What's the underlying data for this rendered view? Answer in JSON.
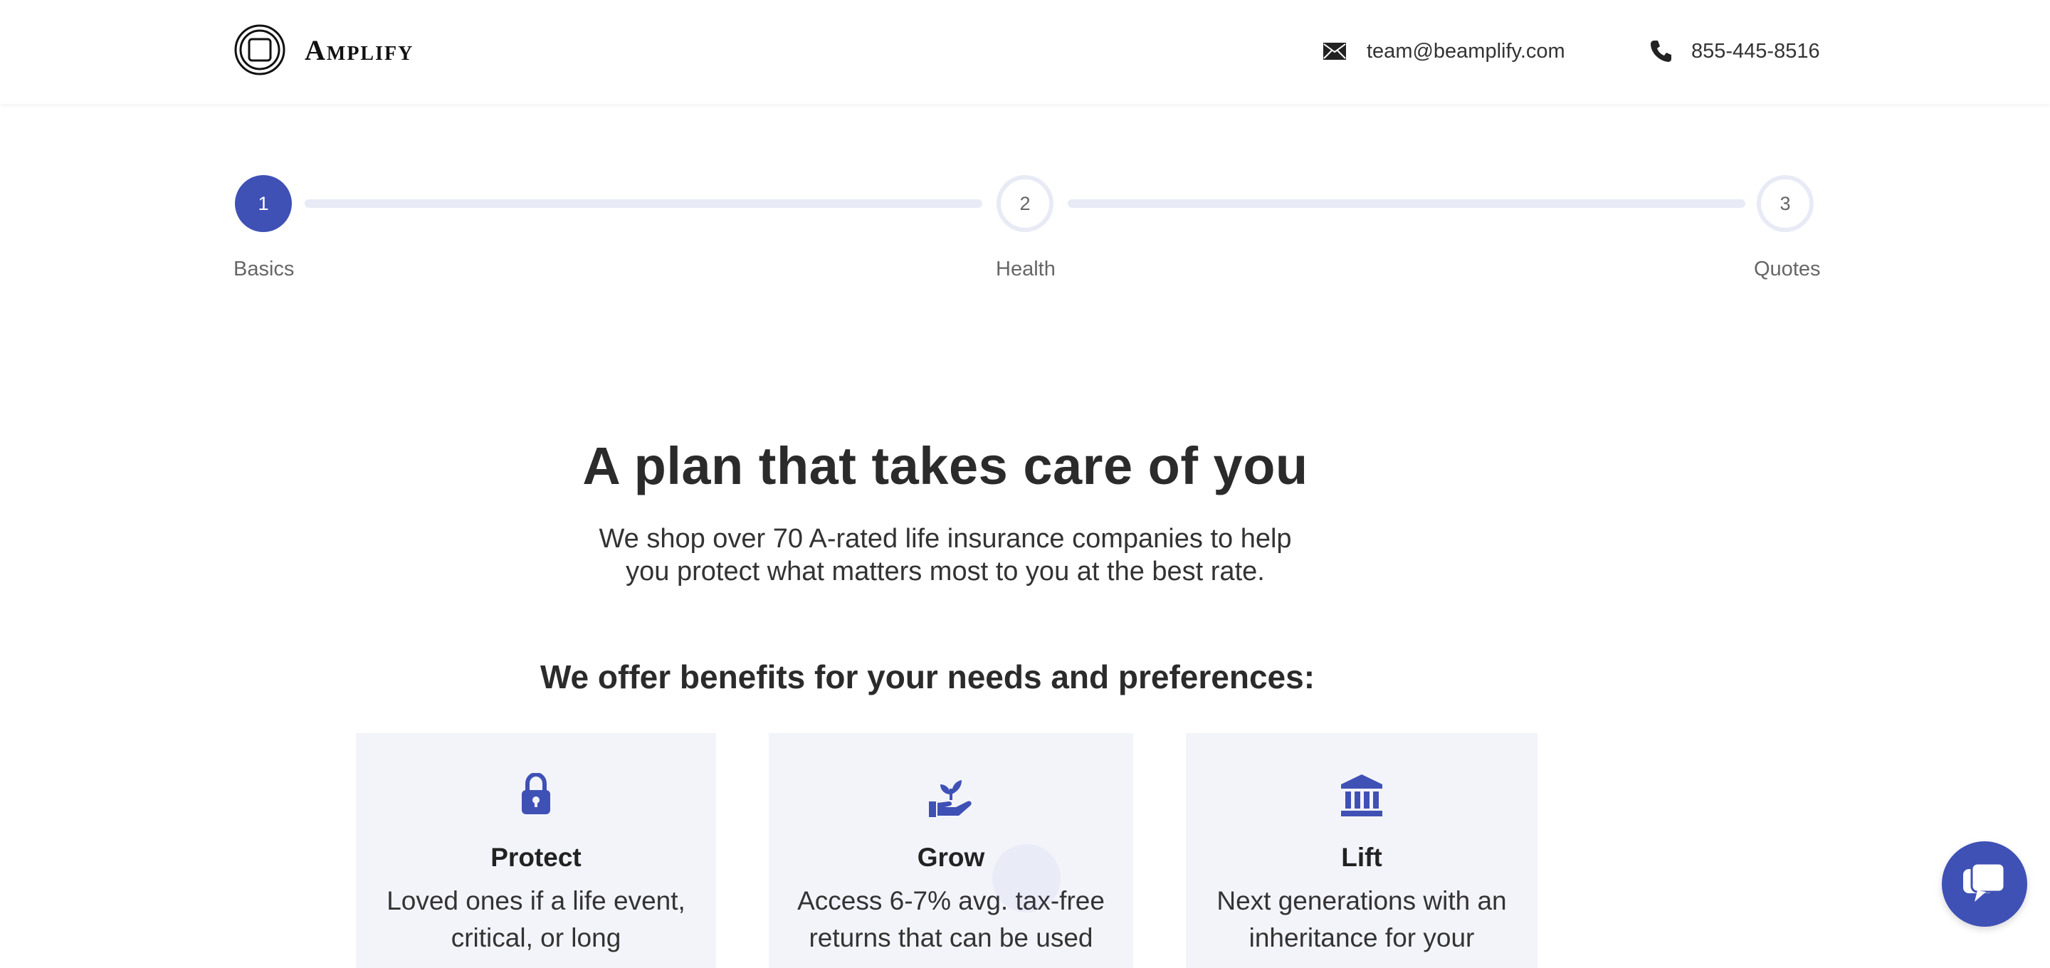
{
  "brand": {
    "name": "Amplify"
  },
  "contact": {
    "email": "team@beamplify.com",
    "phone": "855-445-8516"
  },
  "stepper": {
    "steps": [
      {
        "number": "1",
        "label": "Basics",
        "state": "active"
      },
      {
        "number": "2",
        "label": "Health",
        "state": "inactive"
      },
      {
        "number": "3",
        "label": "Quotes",
        "state": "inactive"
      }
    ]
  },
  "hero": {
    "title": "A plan that takes care of you",
    "subtitle": "We shop over 70 A-rated life insurance companies to help you protect what matters most to you at the best rate."
  },
  "benefits": {
    "title": "We offer benefits for your needs and preferences:",
    "cards": [
      {
        "icon": "lock-icon",
        "title": "Protect",
        "description": "Loved ones if a life event, critical, or long"
      },
      {
        "icon": "hand-plant-icon",
        "title": "Grow",
        "description": "Access 6-7% avg. tax-free returns that can be used"
      },
      {
        "icon": "bank-icon",
        "title": "Lift",
        "description": "Next generations with an inheritance for your"
      }
    ]
  },
  "colors": {
    "accent": "#3f51b5",
    "track": "#e8ebf6",
    "card_bg": "#f3f4fa"
  }
}
